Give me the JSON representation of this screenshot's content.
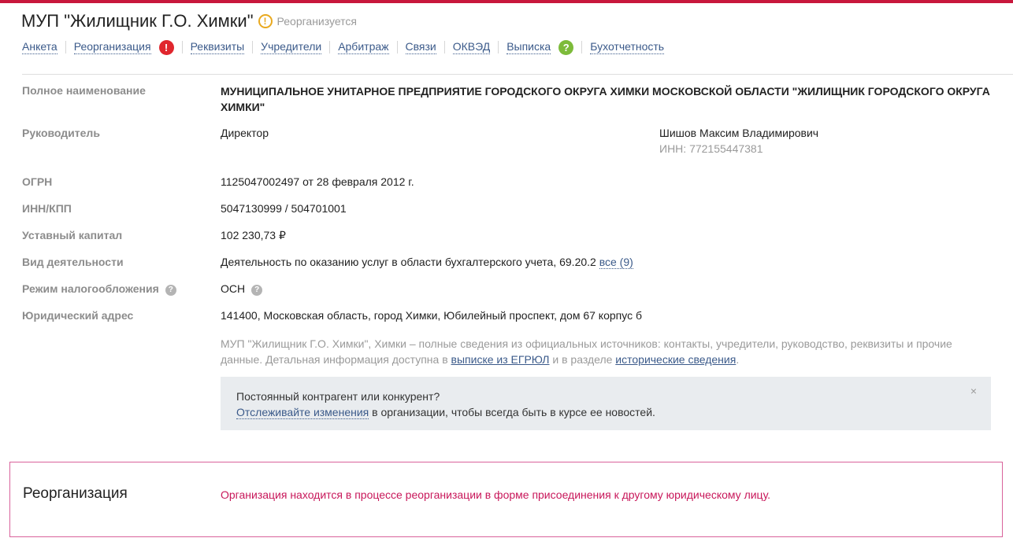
{
  "header": {
    "title": "МУП \"Жилищник Г.О. Химки\"",
    "status_icon": "warning-icon",
    "status": "Реорганизуется"
  },
  "tabs": [
    {
      "label": "Анкета"
    },
    {
      "label": "Реорганизация",
      "badge": "!"
    },
    {
      "label": "Реквизиты"
    },
    {
      "label": "Учредители"
    },
    {
      "label": "Арбитраж"
    },
    {
      "label": "Связи"
    },
    {
      "label": "ОКВЭД"
    },
    {
      "label": "Выписка",
      "badge": "?"
    },
    {
      "label": "Бухотчетность"
    }
  ],
  "colors": {
    "accent": "#c8173c",
    "link": "#3b5a8a",
    "badge_red": "#e0262d",
    "badge_green": "#7dbb3a",
    "reorg_text": "#c8175a"
  },
  "fields": {
    "full_name": {
      "label": "Полное наименование",
      "value": "МУНИЦИПАЛЬНОЕ УНИТАРНОЕ ПРЕДПРИЯТИЕ ГОРОДСКОГО ОКРУГА ХИМКИ МОСКОВСКОЙ ОБЛАСТИ \"ЖИЛИЩНИК ГОРОДСКОГО ОКРУГА ХИМКИ\""
    },
    "head": {
      "label": "Руководитель",
      "position": "Директор",
      "name": "Шишов Максим Владимирович",
      "inn": "ИНН: 772155447381"
    },
    "ogrn": {
      "label": "ОГРН",
      "value": "1125047002497 от 28 февраля 2012 г."
    },
    "inn_kpp": {
      "label": "ИНН/КПП",
      "value": "5047130999 / 504701001"
    },
    "capital": {
      "label": "Уставный капитал",
      "value": "102 230,73 ₽"
    },
    "activity": {
      "label": "Вид деятельности",
      "value": "Деятельность по оказанию услуг в области бухгалтерского учета, 69.20.2",
      "link": "все (9)"
    },
    "tax_regime": {
      "label": "Режим налогообложения",
      "help": "?",
      "value": "ОСН",
      "value_help": "?"
    },
    "address": {
      "label": "Юридический адрес",
      "value": "141400, Московская область, город Химки, Юбилейный проспект, дом 67 корпус б"
    }
  },
  "description": {
    "text1": "МУП \"Жилищник Г.О. Химки\", Химки – полные сведения из официальных источников: контакты, учредители, руководство, реквизиты и прочие данные. Детальная информация доступна в ",
    "link1": "выписке из ЕГРЮЛ",
    "text2": " и в разделе ",
    "link2": "исторические сведения",
    "text3": "."
  },
  "notice": {
    "line1": "Постоянный контрагент или конкурент?",
    "link": "Отслеживайте изменения",
    "line2_rest": " в организации, чтобы всегда быть в курсе ее новостей.",
    "close": "×"
  },
  "reorganization": {
    "title": "Реорганизация",
    "text": "Организация находится в процессе реорганизации в форме присоединения к другому юридическому лицу."
  }
}
